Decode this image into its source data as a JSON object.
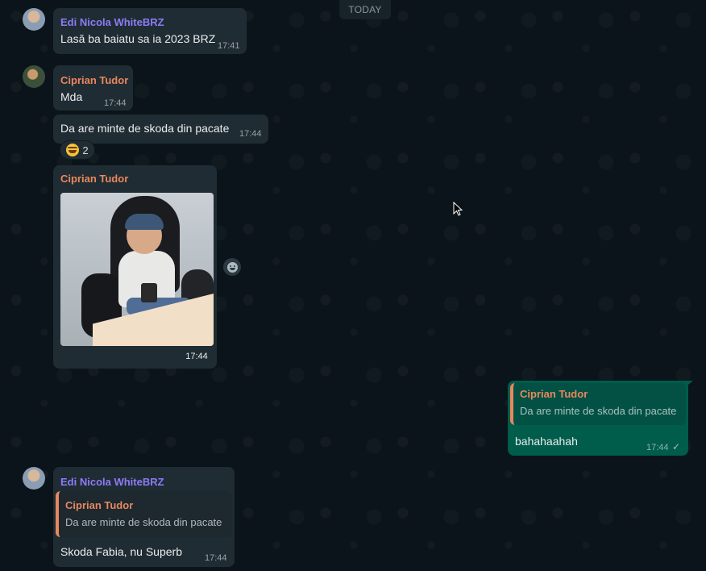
{
  "date_divider": "TODAY",
  "messages": [
    {
      "sender": "Edi Nicola WhiteBRZ",
      "text": "Lasă ba baiatu sa ia 2023 BRZ",
      "time": "17:41"
    },
    {
      "sender": "Ciprian Tudor",
      "text": "Mda",
      "time": "17:44"
    },
    {
      "text": "Da are minte de skoda din pacate",
      "time": "17:44",
      "reaction": {
        "emoji": "laughing-tears-emoji",
        "count": "2"
      }
    },
    {
      "sender": "Ciprian Tudor",
      "image": "photo-child-in-office-chair",
      "time": "17:44"
    },
    {
      "quoted": {
        "sender": "Ciprian Tudor",
        "text": "Da are minte de skoda din pacate"
      },
      "text": "bahahaahah",
      "time": "17:44",
      "status_icon": "single-check-icon",
      "outgoing": true
    },
    {
      "sender": "Edi Nicola WhiteBRZ",
      "quoted": {
        "sender": "Ciprian Tudor",
        "text": "Da are minte de skoda din pacate"
      },
      "text": "Skoda Fabia, nu Superb",
      "time": "17:44"
    }
  ],
  "check_glyph": "✓",
  "colors": {
    "background": "#0b141a",
    "incoming_bubble": "#202c33",
    "outgoing_bubble": "#005c4b",
    "sender_edi": "#8b7cf6",
    "sender_ciprian": "#e9875e"
  }
}
